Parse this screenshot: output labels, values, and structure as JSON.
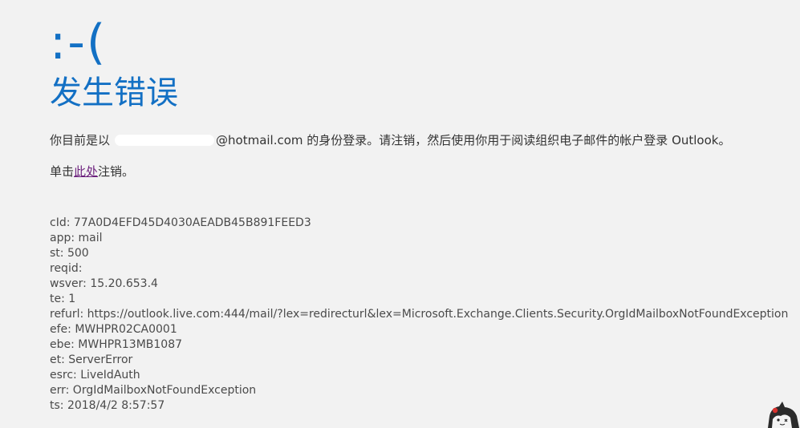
{
  "page": {
    "sad_face": ":-(",
    "title": "发生错误"
  },
  "message": {
    "prefix": "你目前是以",
    "redacted_account": "",
    "domain_suffix": "@hotmail.com",
    "suffix": " 的身份登录。请注销，然后使用你用于阅读组织电子邮件的帐户登录 Outlook。"
  },
  "signout": {
    "prefix": "单击",
    "link_text": "此处",
    "suffix": "注销。"
  },
  "diagnostics": [
    "cId: 77A0D4EFD45D4030AEADB45B891FEED3",
    "app: mail",
    "st: 500",
    "reqid:",
    "wsver: 15.20.653.4",
    "te: 1",
    "refurl: https://outlook.live.com:444/mail/?lex=redirecturl&lex=Microsoft.Exchange.Clients.Security.OrgIdMailboxNotFoundException",
    "efe: MWHPR02CA0001",
    "ebe: MWHPR13MB1087",
    "et: ServerError",
    "esrc: LiveIdAuth",
    "err: OrgIdMailboxNotFoundException",
    "ts: 2018/4/2 8:57:57"
  ],
  "colors": {
    "accent": "#1370c4",
    "link_visited": "#6b1f7c",
    "background": "#f2f2f2"
  },
  "icons": {
    "corner": "mascot-icon"
  }
}
